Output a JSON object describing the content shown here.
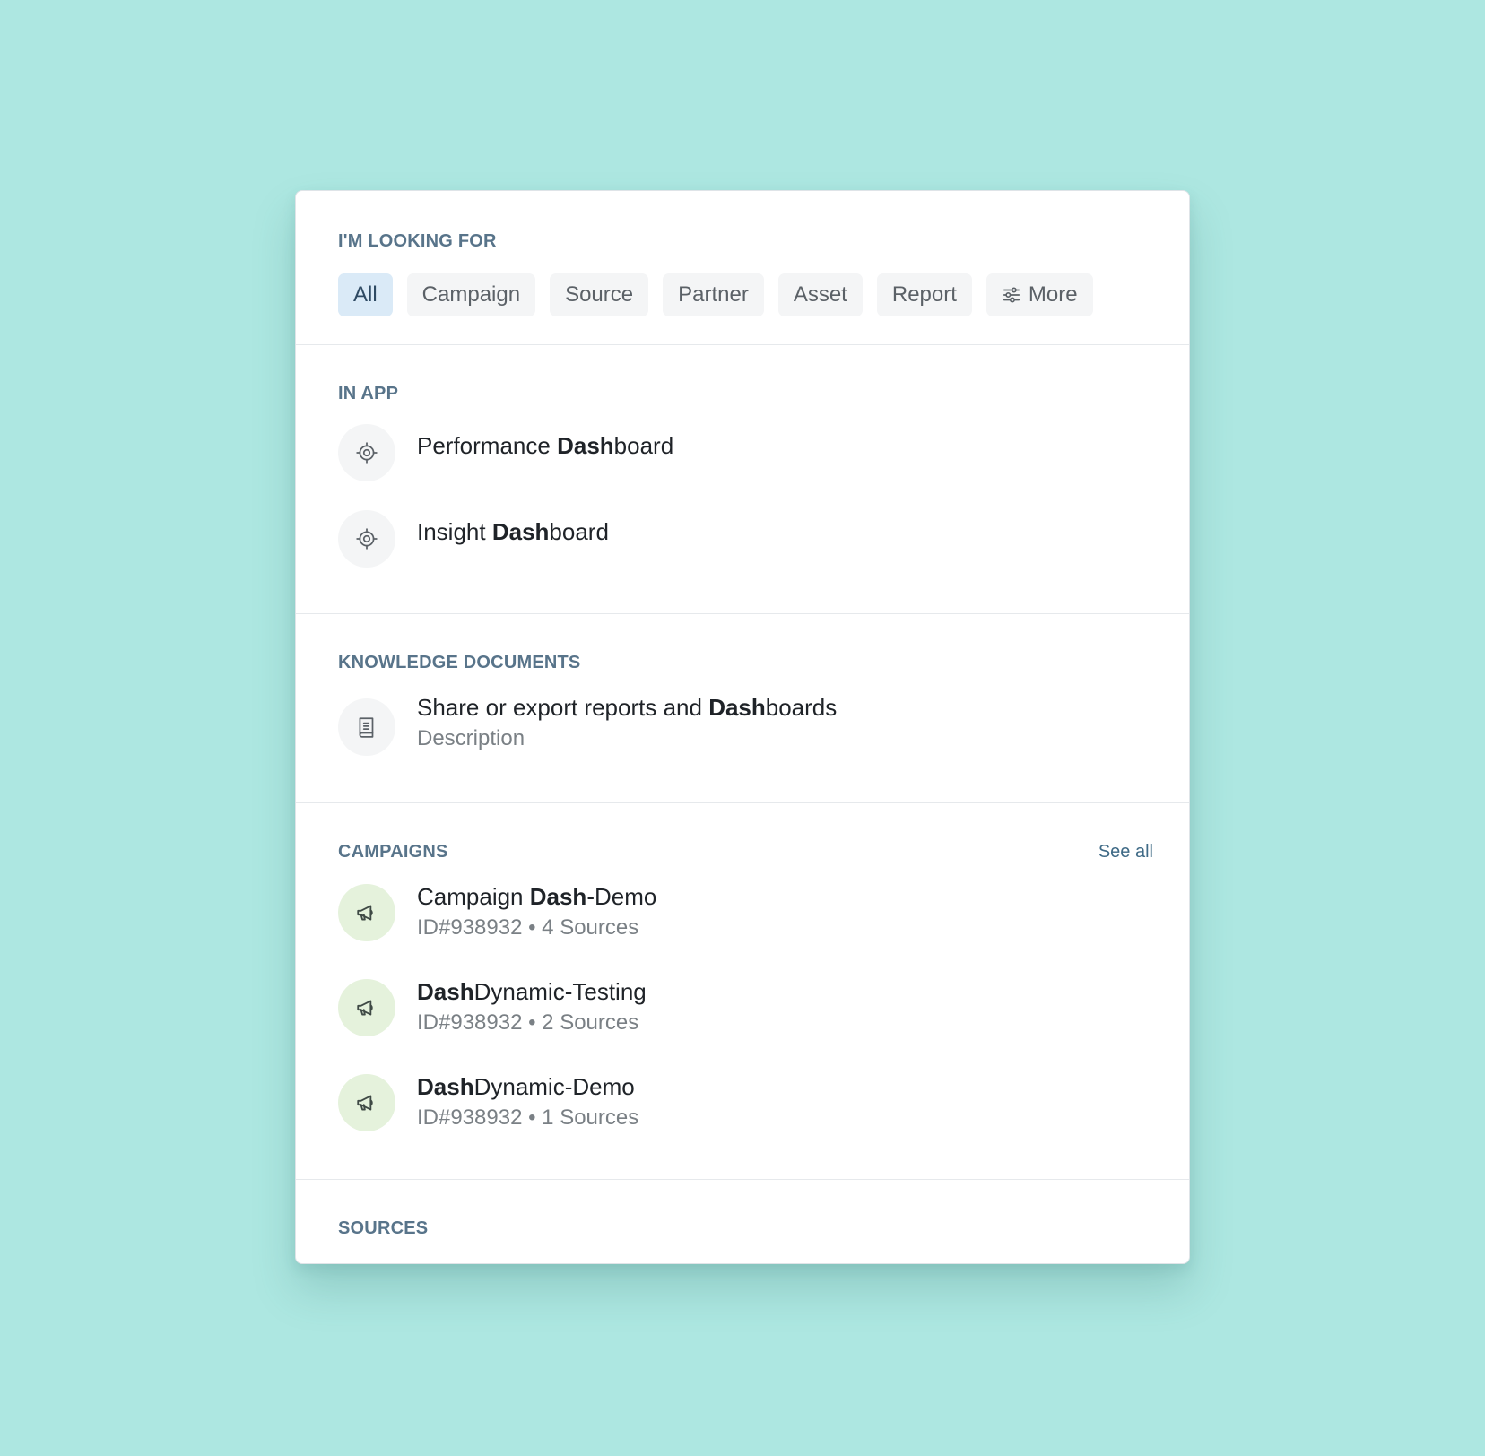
{
  "filters": {
    "title": "I'M LOOKING FOR",
    "chips": [
      "All",
      "Campaign",
      "Source",
      "Partner",
      "Asset",
      "Report"
    ],
    "more_label": "More"
  },
  "in_app": {
    "title": "IN APP",
    "items": [
      {
        "prefix": "Performance ",
        "match": "Dash",
        "suffix": "board",
        "icon": "target-icon"
      },
      {
        "prefix": "Insight ",
        "match": "Dash",
        "suffix": "board",
        "icon": "target-icon"
      }
    ]
  },
  "knowledge": {
    "title": "KNOWLEDGE DOCUMENTS",
    "items": [
      {
        "prefix": "Share or export reports and ",
        "match": "Dash",
        "suffix": "boards",
        "subtitle": "Description",
        "icon": "document-icon"
      }
    ]
  },
  "campaigns": {
    "title": "CAMPAIGNS",
    "see_all": "See all",
    "items": [
      {
        "prefix": "Campaign ",
        "match": "Dash",
        "suffix": "-Demo",
        "subtitle": "ID#938932 • 4 Sources",
        "icon": "megaphone-icon"
      },
      {
        "prefix": "",
        "match": "Dash",
        "suffix": "Dynamic-Testing",
        "subtitle": "ID#938932 • 2 Sources",
        "icon": "megaphone-icon"
      },
      {
        "prefix": "",
        "match": "Dash",
        "suffix": "Dynamic-Demo",
        "subtitle": "ID#938932 • 1 Sources",
        "icon": "megaphone-icon"
      }
    ]
  },
  "sources": {
    "title": "SOURCES"
  },
  "colors": {
    "background": "#ade7e1",
    "active_chip": "#daeaf7",
    "section_title": "#58748a",
    "campaign_icon_bg": "#e5f2dc"
  }
}
